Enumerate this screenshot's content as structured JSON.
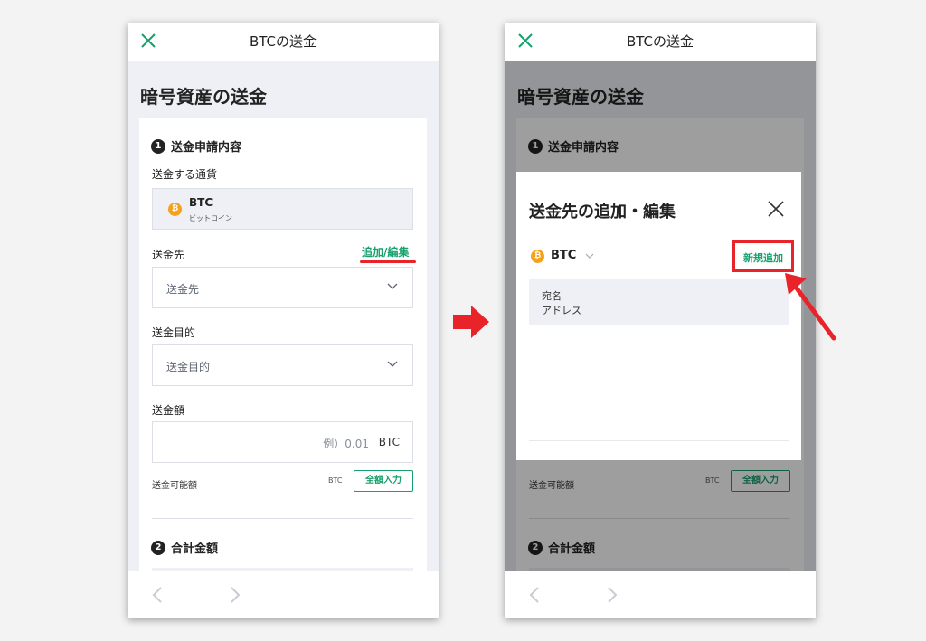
{
  "left": {
    "topbar_title": "BTCの送金",
    "page_title": "暗号資産の送金",
    "section1": {
      "num": "1",
      "title": "送金申請内容"
    },
    "currency_label": "送金する通貨",
    "coin": {
      "symbol": "BTC",
      "name": "ビットコイン",
      "icon_glyph": "₿"
    },
    "dest_label": "送金先",
    "add_edit_link": "追加/編集",
    "dest_placeholder": "送金先",
    "purpose_label": "送金目的",
    "purpose_placeholder": "送金目的",
    "amount_label": "送金額",
    "amount_placeholder": "例）0.01",
    "amount_unit": "BTC",
    "available_label": "送金可能額",
    "available_unit": "BTC",
    "fill_all_button": "全額入力",
    "section2": {
      "num": "2",
      "title": "合計金額"
    }
  },
  "right": {
    "topbar_title": "BTCの送金",
    "page_title": "暗号資産の送金",
    "section1": {
      "num": "1",
      "title": "送金申請内容"
    },
    "available_label": "送金可能額",
    "available_unit": "BTC",
    "fill_all_button": "全額入力",
    "section2": {
      "num": "2",
      "title": "合計金額"
    },
    "modal": {
      "title": "送金先の追加・編集",
      "coin_symbol": "BTC",
      "coin_icon_glyph": "₿",
      "new_add_button": "新規追加",
      "row_line1": "宛名",
      "row_line2": "アドレス"
    }
  },
  "colors": {
    "accent_green": "#16a06c",
    "highlight_red": "#e8232a",
    "btc_orange": "#f4a11b"
  }
}
